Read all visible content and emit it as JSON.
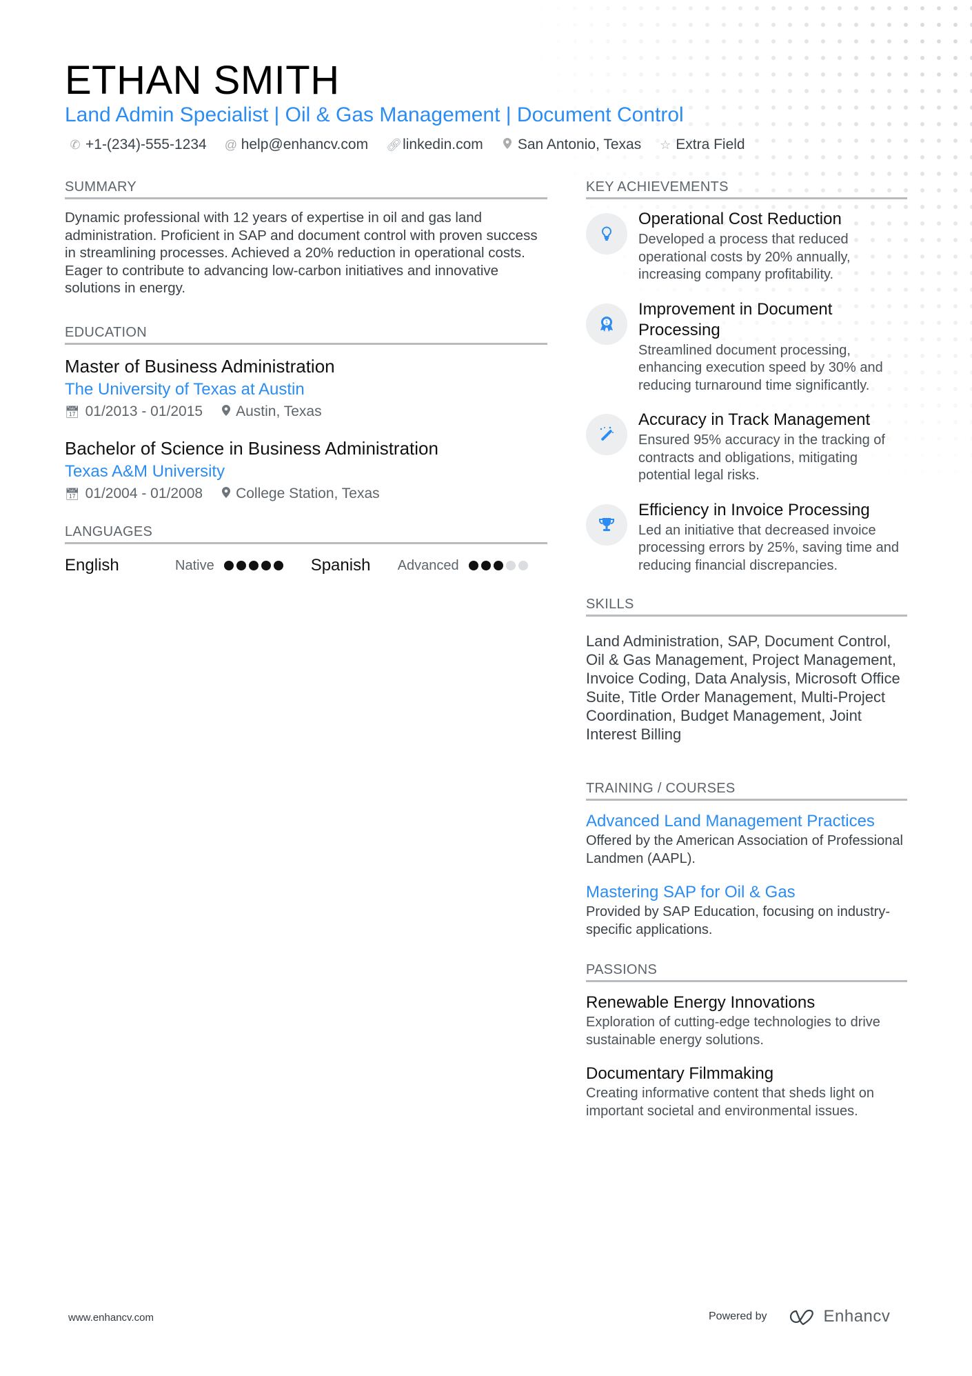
{
  "header": {
    "name": "ETHAN SMITH",
    "headline": "Land Admin Specialist | Oil & Gas Management | Document Control",
    "contacts": [
      {
        "icon": "phone-icon",
        "text": "+1-(234)-555-1234"
      },
      {
        "icon": "at-icon",
        "text": "help@enhancv.com"
      },
      {
        "icon": "link-icon",
        "text": "linkedin.com"
      },
      {
        "icon": "location-pin-icon",
        "text": "San Antonio, Texas"
      },
      {
        "icon": "star-icon",
        "text": "Extra Field"
      }
    ]
  },
  "summary": {
    "title": "SUMMARY",
    "text": "Dynamic professional with 12 years of expertise in oil and gas land administration. Proficient in SAP and document control with proven success in streamlining processes. Achieved a 20% reduction in operational costs. Eager to contribute to advancing low-carbon initiatives and innovative solutions in energy."
  },
  "education": {
    "title": "EDUCATION",
    "items": [
      {
        "degree": "Master of Business Administration",
        "school": "The University of Texas at Austin",
        "dates": "01/2013 - 01/2015",
        "location": "Austin, Texas"
      },
      {
        "degree": "Bachelor of Science in Business Administration",
        "school": "Texas A&M University",
        "dates": "01/2004 - 01/2008",
        "location": "College Station, Texas"
      }
    ]
  },
  "languages": {
    "title": "LANGUAGES",
    "items": [
      {
        "name": "English",
        "level": "Native",
        "rating": 5,
        "max": 5
      },
      {
        "name": "Spanish",
        "level": "Advanced",
        "rating": 3,
        "max": 5
      }
    ]
  },
  "achievements": {
    "title": "KEY ACHIEVEMENTS",
    "accent": "#2b8cf2",
    "items": [
      {
        "icon": "lightbulb-icon",
        "title": "Operational Cost Reduction",
        "desc": "Developed a process that reduced operational costs by 20% annually, increasing company profitability."
      },
      {
        "icon": "award-ribbon-icon",
        "title": "Improvement in Document Processing",
        "desc": "Streamlined document processing, enhancing execution speed by 30% and reducing turnaround time significantly."
      },
      {
        "icon": "magic-wand-icon",
        "title": "Accuracy in Track Management",
        "desc": "Ensured 95% accuracy in the tracking of contracts and obligations, mitigating potential legal risks."
      },
      {
        "icon": "trophy-icon",
        "title": "Efficiency in Invoice Processing",
        "desc": "Led an initiative that decreased invoice processing errors by 25%, saving time and reducing financial discrepancies."
      }
    ]
  },
  "skills": {
    "title": "SKILLS",
    "text": "Land Administration, SAP, Document Control, Oil & Gas Management, Project Management, Invoice Coding, Data Analysis, Microsoft Office Suite, Title Order Management, Multi-Project Coordination, Budget Management, Joint Interest Billing"
  },
  "training": {
    "title": "TRAINING / COURSES",
    "items": [
      {
        "title": "Advanced Land Management Practices",
        "desc": "Offered by the American Association of Professional Landmen (AAPL)."
      },
      {
        "title": "Mastering SAP for Oil & Gas",
        "desc": "Provided by SAP Education, focusing on industry-specific applications."
      }
    ]
  },
  "passions": {
    "title": "PASSIONS",
    "items": [
      {
        "title": "Renewable Energy Innovations",
        "desc": "Exploration of cutting-edge technologies to drive sustainable energy solutions."
      },
      {
        "title": "Documentary Filmmaking",
        "desc": "Creating informative content that sheds light on important societal and environmental issues."
      }
    ]
  },
  "footer": {
    "website": "www.enhancv.com",
    "powered_by": "Powered by",
    "brand": "Enhancv"
  }
}
